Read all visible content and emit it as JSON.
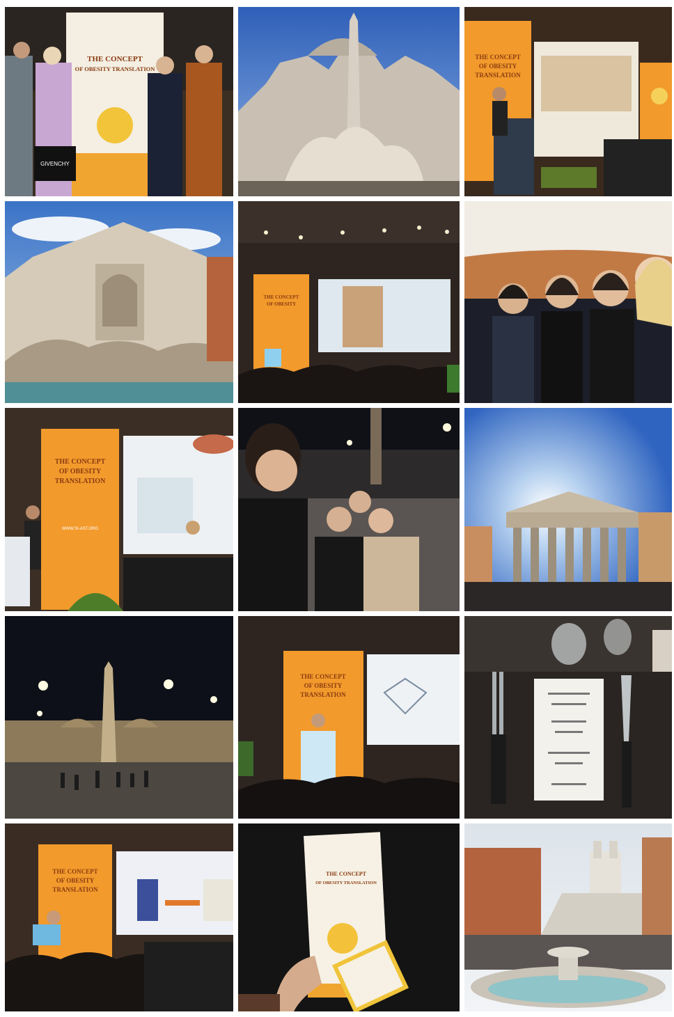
{
  "collage": {
    "poster_title_line1": "THE CONCEPT",
    "poster_title_line2": "OF OBESITY TRANSLATION",
    "banner_line1": "THE CONCEPT",
    "banner_line2": "OF OBESITY",
    "banner_line3": "TRANSLATION",
    "bag_brand": "GIVENCHY",
    "website": "WWW.SI-AST.ORG"
  },
  "palette": {
    "orange": "#f39a2a",
    "sky": "#3b6fc8",
    "night": "#101218",
    "stone": "#d8cdbb"
  },
  "photos": [
    {
      "icon": "group-photo-poster"
    },
    {
      "icon": "fountain-obelisk-church"
    },
    {
      "icon": "conference-stage-banner"
    },
    {
      "icon": "trevi-fountain"
    },
    {
      "icon": "conference-hall-screen"
    },
    {
      "icon": "group-selfie-seats"
    },
    {
      "icon": "speaker-podium-slides"
    },
    {
      "icon": "night-selfie-piazza"
    },
    {
      "icon": "pantheon"
    },
    {
      "icon": "piazza-del-popolo-night"
    },
    {
      "icon": "conference-speaker-diagram"
    },
    {
      "icon": "dinner-table-menu"
    },
    {
      "icon": "speaker-audience-slides"
    },
    {
      "icon": "hand-holding-programme"
    },
    {
      "icon": "spanish-steps-fountain"
    }
  ]
}
